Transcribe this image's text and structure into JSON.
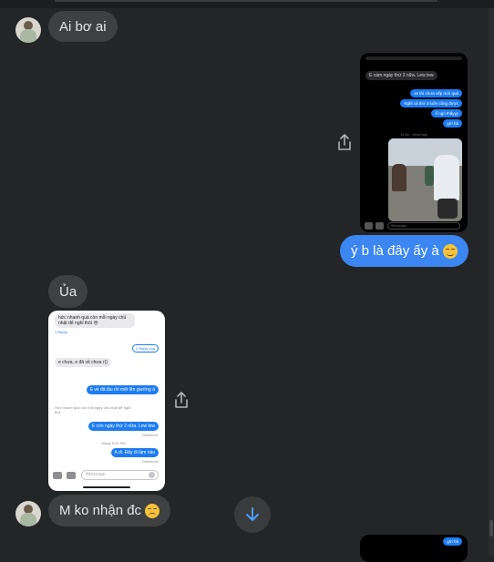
{
  "messages": {
    "m1": {
      "text": "Ai bơ ai",
      "sender": "other"
    },
    "m3": {
      "text": "ý b là đây ấy à",
      "emoji": "unamused-face-icon",
      "sender": "me"
    },
    "m4": {
      "text": "Ủa",
      "sender": "other"
    },
    "m6": {
      "text": "M ko nhận đc",
      "emoji": "disappointed-face-icon",
      "sender": "other"
    }
  },
  "shot1": {
    "grey_msg": "E cám ngày thứ 2 nữa. Lew lew",
    "blue_msgs": [
      "xe thì chưa xếp mới quá",
      "Nghỉ cả thứ 3 luôn cũng được",
      "ể ngò thấyyy",
      "gửi hả"
    ],
    "timestamp": "11:51 · Hôm nay",
    "input_placeholder": "iMessage"
  },
  "shot2": {
    "grey1": "hức nhanh quá còn mỗi ngày chủ nhật để nghỉ thôi 😔",
    "reply_label": "1 Reply",
    "quote_label": "1 Reply của",
    "grey2": "e chưa, e đã về chưa r()",
    "blue1": "E về đã lâu rồi mệt lên giường á",
    "reply_context": "Hức nhanh quá còn mỗi ngày chủ nhật để nghỉ thôi",
    "blue2": "E còn ngày thứ 2 nữa. Lew lew",
    "delivered": "Delivered",
    "ts": "Today 9:21 PM",
    "blue3": "A di. Đây đi làm nào",
    "delivered2": "Delivered",
    "input_placeholder": "iMessage"
  },
  "shot3": {
    "blue": "gửi hả"
  },
  "colors": {
    "background": "#242526",
    "incoming_bubble": "#3e4042",
    "outgoing_bubble": "#3b86f0"
  }
}
